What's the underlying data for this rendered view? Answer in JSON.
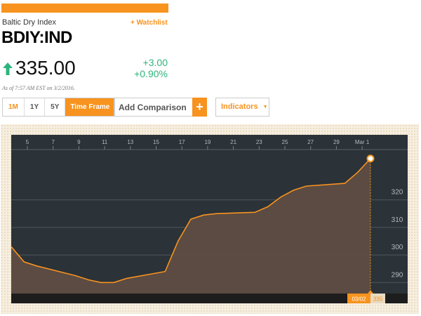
{
  "header": {
    "index_name": "Baltic Dry Index",
    "watchlist_label": "+ Watchlist",
    "ticker": "BDIY:IND"
  },
  "quote": {
    "price": "335.00",
    "change": "+3.00",
    "change_pct": "+0.90%",
    "as_of": "As of 7:57 AM EST on 3/2/2016.",
    "up_color": "#2db47d",
    "direction_icon": "arrow-up-icon"
  },
  "toolbar": {
    "ranges": [
      "1M",
      "1Y",
      "5Y"
    ],
    "active_range": "1M",
    "time_frame_label": "Time Frame",
    "compare_placeholder": "Add Comparison",
    "add_label": "+",
    "indicators_label": "Indicators",
    "accent": "#f7931e"
  },
  "chart_data": {
    "type": "area",
    "x_ticks": [
      "5",
      "7",
      "9",
      "11",
      "13",
      "15",
      "17",
      "19",
      "21",
      "23",
      "25",
      "27",
      "29",
      "Mar 1"
    ],
    "x": [
      "2016-02-03",
      "2016-02-04",
      "2016-02-05",
      "2016-02-08",
      "2016-02-09",
      "2016-02-10",
      "2016-02-11",
      "2016-02-12",
      "2016-02-15",
      "2016-02-16",
      "2016-02-17",
      "2016-02-18",
      "2016-02-19",
      "2016-02-22",
      "2016-02-23",
      "2016-02-24",
      "2016-02-25",
      "2016-02-26",
      "2016-02-29",
      "2016-03-01",
      "2016-03-02"
    ],
    "values": [
      303,
      297.5,
      296,
      292.5,
      291,
      290,
      290,
      291.5,
      294,
      305,
      313,
      314.5,
      315,
      315.5,
      317.5,
      321,
      323.5,
      325,
      326,
      330,
      332
    ],
    "y_ticks": [
      290,
      300,
      310,
      320
    ],
    "ylim": [
      286,
      338
    ],
    "last_label": "03/02",
    "last_value": "335",
    "line_color": "#f7931e",
    "fill_color": "#5e4d42",
    "bg_color": "#2b3238",
    "grid": true
  }
}
